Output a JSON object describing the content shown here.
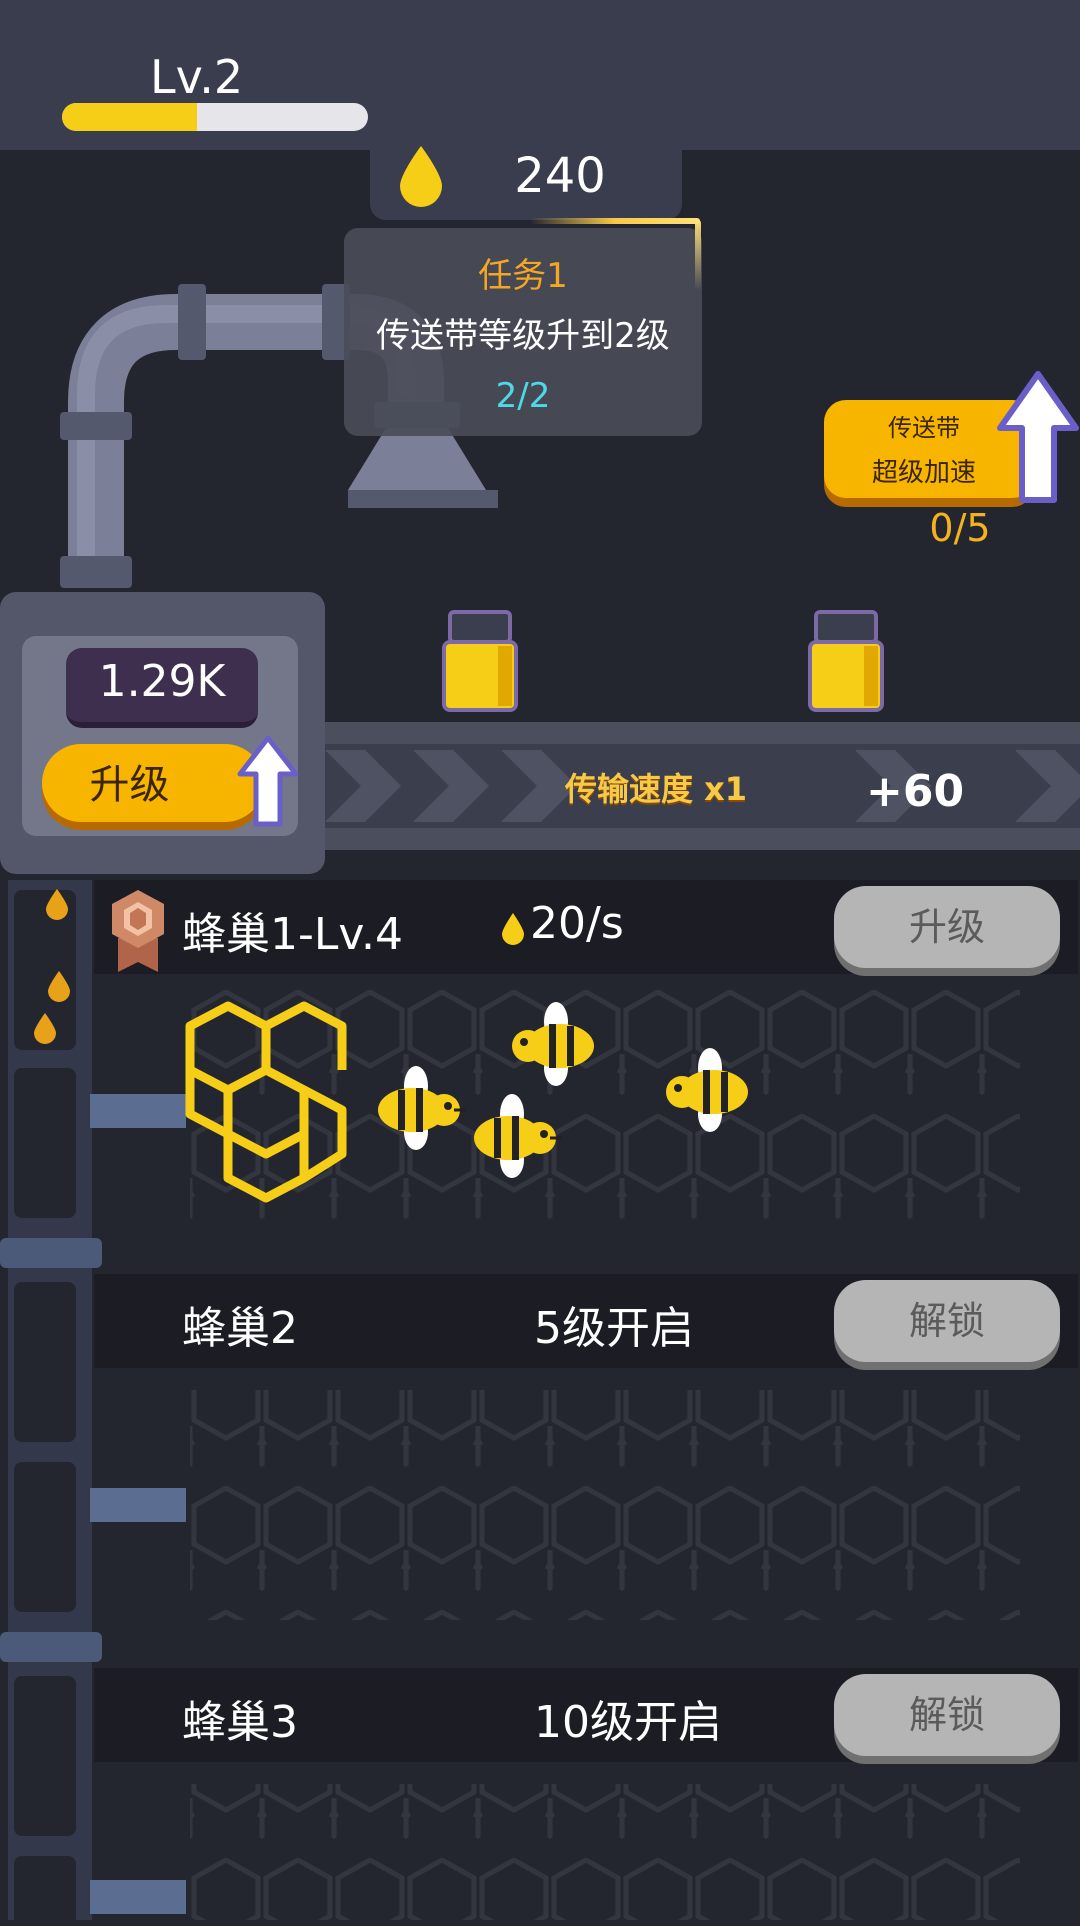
{
  "header": {
    "level_label": "Lv.2",
    "xp_progress": 0.44,
    "honey_count": "240"
  },
  "quest": {
    "title": "任务1",
    "description": "传送带等级升到2级",
    "progress": "2/2"
  },
  "boost": {
    "line1": "传送带",
    "line2": "超级加速",
    "count": "0/5"
  },
  "factory": {
    "stored_value": "1.29K",
    "upgrade_label": "升级"
  },
  "conveyor": {
    "speed_label": "传输速度  x1",
    "bonus": "+60"
  },
  "hives": [
    {
      "name": "蜂巢1-Lv.4",
      "rate": "20/s",
      "button": "升级"
    },
    {
      "name": "蜂巢2",
      "unlock_text": "5级开启",
      "button": "解锁"
    },
    {
      "name": "蜂巢3",
      "unlock_text": "10级开启",
      "button": "解锁"
    }
  ],
  "colors": {
    "background": "#24262f",
    "accent_orange": "#f7b500",
    "honey_yellow": "#f6ce18",
    "quest_progress": "#4fd8e8"
  }
}
